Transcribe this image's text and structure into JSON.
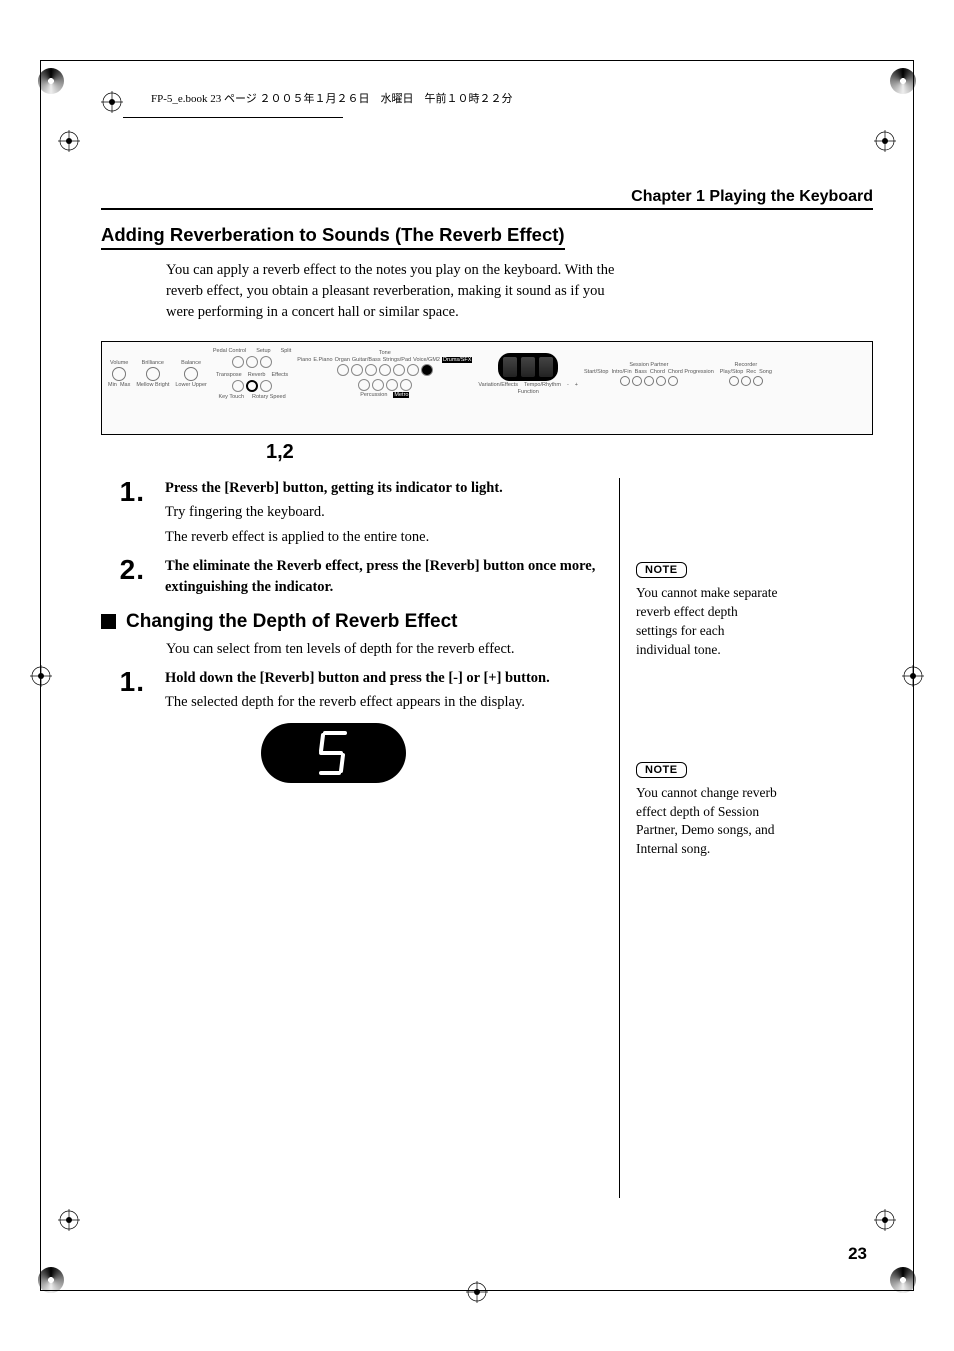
{
  "header": {
    "book_line": "FP-5_e.book 23 ページ ２００５年１月２６日　水曜日　午前１０時２２分"
  },
  "chapter": {
    "title": "Chapter 1 Playing the Keyboard"
  },
  "section": {
    "title": "Adding Reverberation to Sounds (The Reverb Effect)",
    "intro": "You can apply a reverb effect to the notes you play on the keyboard. With the reverb effect, you obtain a pleasant reverberation, making it sound as if you were performing in a concert hall or similar space."
  },
  "panel": {
    "caption": "1,2",
    "labels": {
      "volume": "Volume",
      "brilliance": "Brilliance",
      "balance": "Balance",
      "pedal": "Pedal Control",
      "setup": "Setup",
      "split": "Split",
      "transpose": "Transpose",
      "reverb": "Reverb",
      "effects": "Effects",
      "key_touch": "Key Touch",
      "rotary": "Rotary Speed",
      "tone": "Tone",
      "piano": "Piano",
      "epiano": "E.Piano",
      "organ": "Organ",
      "guitar_bass": "Guitar/Bass",
      "strings_pad": "Strings/Pad",
      "voice_gm2": "Voice/GM2",
      "drums_sfx": "Drums/SFX",
      "variation": "Variation/Effects",
      "tempo": "Tempo/Rhythm",
      "session": "Session Partner",
      "start_stop": "Start/Stop",
      "intro_fin": "Intro/Fin",
      "bass": "Bass",
      "chord": "Chord",
      "prog": "Chord Progression",
      "recorder": "Recorder",
      "play_stop": "Play/Stop",
      "rec": "Rec",
      "song": "Song",
      "min": "Min",
      "max": "Max",
      "mellow": "Mellow",
      "bright": "Bright",
      "lower": "Lower",
      "upper": "Upper",
      "minus": "-",
      "plus": "+",
      "function": "Function",
      "percussion": "Percussion",
      "metro": "Metro"
    }
  },
  "steps": {
    "s1_num": "1.",
    "s1_head": "Press the [Reverb] button, getting its indicator to light.",
    "s1_sub1": "Try fingering the keyboard.",
    "s1_sub2": "The reverb effect is applied to the entire tone.",
    "s2_num": "2.",
    "s2_head": "The eliminate the Reverb effect, press the [Reverb] button once more, extinguishing the indicator."
  },
  "subsection": {
    "title": "Changing the Depth of Reverb Effect",
    "intro": "You can select from ten levels of depth for the reverb effect.",
    "s1_num": "1.",
    "s1_head": "Hold down the [Reverb] button and press the [-] or [+] button.",
    "s1_sub": "The selected depth for the reverb effect appears in the display.",
    "display_value": "5"
  },
  "notes": {
    "label": "NOTE",
    "n1": "You cannot make separate reverb effect depth settings for each individual tone.",
    "n2": "You cannot change reverb effect depth of Session Partner, Demo songs, and Internal song."
  },
  "page_number": "23",
  "chart_data": null
}
